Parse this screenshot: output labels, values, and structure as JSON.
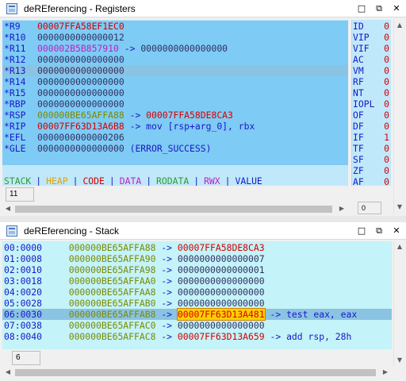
{
  "registers_window": {
    "title": "deREferencing - Registers",
    "rows": [
      {
        "name": "*R9",
        "value": "00007FFA58EF1EC0",
        "value_color": "#d40000",
        "arrow": "",
        "target": "",
        "target_color": ""
      },
      {
        "name": "*R10",
        "value": "0000000000000012",
        "value_color": "#303060",
        "arrow": "",
        "target": "",
        "target_color": ""
      },
      {
        "name": "*R11",
        "value": "000002B5B857910",
        "value_color": "#c020c0",
        "arrow": "->",
        "target": "0000000000000000",
        "target_color": "#303060"
      },
      {
        "name": "*R12",
        "value": "0000000000000000",
        "value_color": "#303060",
        "arrow": "",
        "target": "",
        "target_color": ""
      },
      {
        "name": "*R13",
        "value": "0000000000000000",
        "value_color": "#303060",
        "arrow": "",
        "target": "",
        "target_color": ""
      },
      {
        "name": "*R14",
        "value": "0000000000000000",
        "value_color": "#303060",
        "arrow": "",
        "target": "",
        "target_color": ""
      },
      {
        "name": "*R15",
        "value": "0000000000000000",
        "value_color": "#303060",
        "arrow": "",
        "target": "",
        "target_color": ""
      },
      {
        "name": "*RBP",
        "value": "0000000000000000",
        "value_color": "#303060",
        "arrow": "",
        "target": "",
        "target_color": ""
      },
      {
        "name": "*RSP",
        "value": "000000BE65AFFA88",
        "value_color": "#7a8a00",
        "arrow": "->",
        "target": "00007FFA58DE8CA3",
        "target_color": "#d40000"
      },
      {
        "name": "*RIP",
        "value": "00007FF63D13A6B8",
        "value_color": "#d40000",
        "arrow": "->",
        "target": "mov [rsp+arg_0], rbx",
        "target_color": "#1818c8"
      },
      {
        "name": "*EFL",
        "value": "0000000000000206",
        "value_color": "#303060",
        "arrow": "",
        "target": "",
        "target_color": ""
      },
      {
        "name": "*GLE",
        "value": "0000000000000000",
        "value_color": "#303060",
        "arrow": "",
        "target": "(ERROR_SUCCESS)",
        "target_color": "#1818c8"
      }
    ],
    "legend": [
      {
        "label": "STACK",
        "color": "#2e9a2e"
      },
      {
        "label": "HEAP",
        "color": "#e0a000"
      },
      {
        "label": "CODE",
        "color": "#d40000"
      },
      {
        "label": "DATA",
        "color": "#c020c0"
      },
      {
        "label": "RODATA",
        "color": "#2e9a2e"
      },
      {
        "label": "RWX",
        "color": "#c020c0"
      },
      {
        "label": "VALUE",
        "color": "#1818c8"
      }
    ],
    "legend_sep": "|",
    "status_left": "11",
    "status_right": "0",
    "flags": [
      {
        "name": "ID",
        "value": "0"
      },
      {
        "name": "VIP",
        "value": "0"
      },
      {
        "name": "VIF",
        "value": "0"
      },
      {
        "name": "AC",
        "value": "0"
      },
      {
        "name": "VM",
        "value": "0"
      },
      {
        "name": "RF",
        "value": "0"
      },
      {
        "name": "NT",
        "value": "0"
      },
      {
        "name": "IOPL",
        "value": "0"
      },
      {
        "name": "OF",
        "value": "0"
      },
      {
        "name": "DF",
        "value": "0"
      },
      {
        "name": "IF",
        "value": "1"
      },
      {
        "name": "TF",
        "value": "0"
      },
      {
        "name": "SF",
        "value": "0"
      },
      {
        "name": "ZF",
        "value": "0"
      },
      {
        "name": "AF",
        "value": "0"
      }
    ]
  },
  "stack_window": {
    "title": "deREferencing - Stack",
    "rows": [
      {
        "idx": "00:0000",
        "addr": "000000BE65AFFA88",
        "arrow": "->",
        "value": "00007FFA58DE8CA3",
        "value_color": "#d40000",
        "arrow2": "",
        "extra": ""
      },
      {
        "idx": "01:0008",
        "addr": "000000BE65AFFA90",
        "arrow": "->",
        "value": "0000000000000007",
        "value_color": "#303060",
        "arrow2": "",
        "extra": ""
      },
      {
        "idx": "02:0010",
        "addr": "000000BE65AFFA98",
        "arrow": "->",
        "value": "0000000000000001",
        "value_color": "#303060",
        "arrow2": "",
        "extra": ""
      },
      {
        "idx": "03:0018",
        "addr": "000000BE65AFFAA0",
        "arrow": "->",
        "value": "0000000000000000",
        "value_color": "#303060",
        "arrow2": "",
        "extra": ""
      },
      {
        "idx": "04:0020",
        "addr": "000000BE65AFFAA8",
        "arrow": "->",
        "value": "0000000000000000",
        "value_color": "#303060",
        "arrow2": "",
        "extra": ""
      },
      {
        "idx": "05:0028",
        "addr": "000000BE65AFFAB0",
        "arrow": "->",
        "value": "0000000000000000",
        "value_color": "#303060",
        "arrow2": "",
        "extra": ""
      },
      {
        "idx": "06:0030",
        "addr": "000000BE65AFFAB8",
        "arrow": "->",
        "value": "00007FF63D13A481",
        "value_color": "#d40000",
        "arrow2": "->",
        "extra": "test eax, eax"
      },
      {
        "idx": "07:0038",
        "addr": "000000BE65AFFAC0",
        "arrow": "->",
        "value": "0000000000000000",
        "value_color": "#303060",
        "arrow2": "",
        "extra": ""
      },
      {
        "idx": "08:0040",
        "addr": "000000BE65AFFAC8",
        "arrow": "->",
        "value": "00007FF63D13A659",
        "value_color": "#d40000",
        "arrow2": "->",
        "extra": "add rsp, 28h"
      }
    ],
    "status_left": "6"
  },
  "window_buttons": {
    "minimize": "□",
    "restore": "⧉",
    "close": "✕"
  }
}
